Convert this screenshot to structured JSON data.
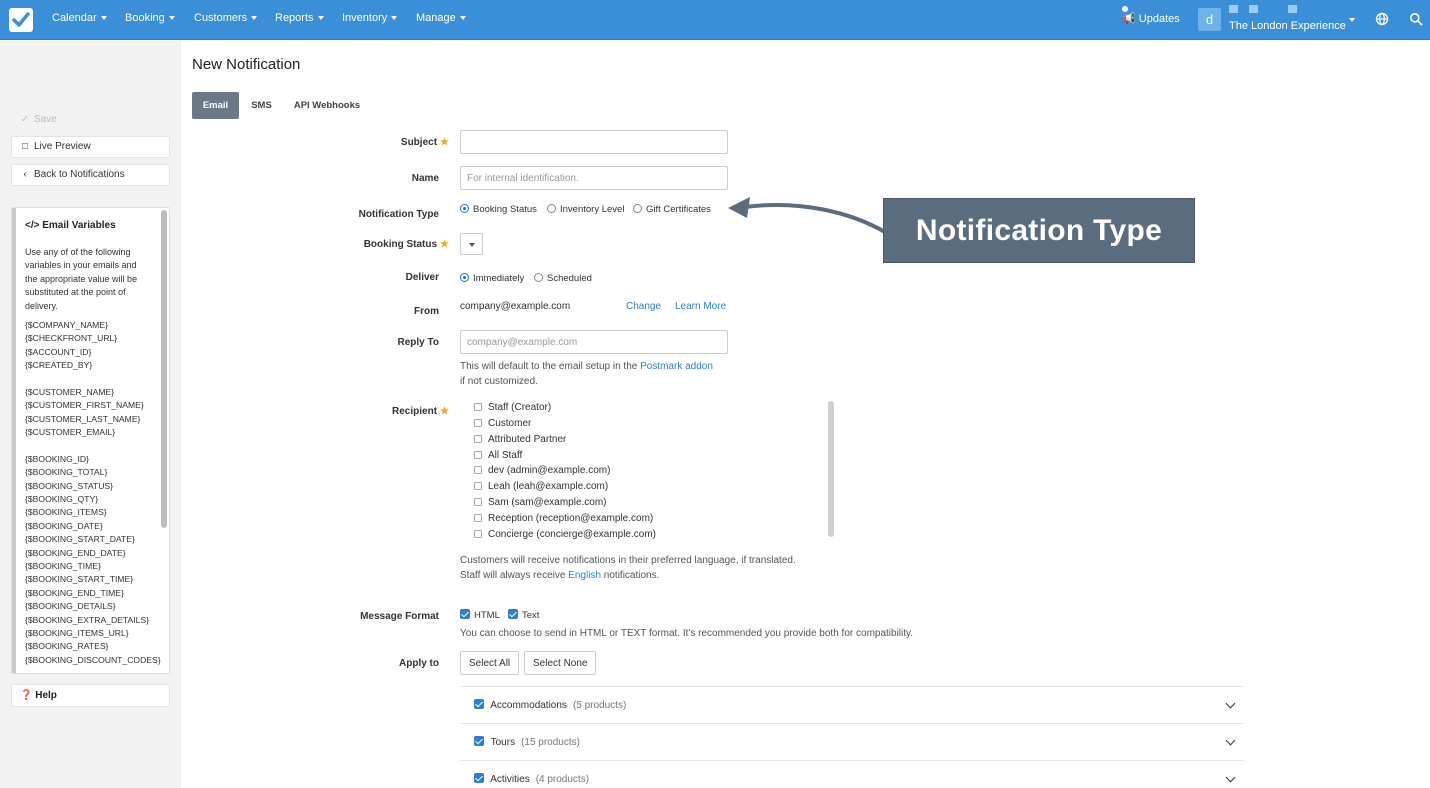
{
  "navbar": {
    "menus": [
      "Calendar",
      "Booking",
      "Customers",
      "Reports",
      "Inventory",
      "Manage"
    ],
    "updates_label": "Updates",
    "avatar_letter": "d",
    "account_name": "The London Experience"
  },
  "sidebar": {
    "save_label": "Save",
    "live_preview_label": "Live Preview",
    "back_label": "Back to Notifications",
    "variables_title": "Email Variables",
    "variables_description": "Use any of of the following variables in your emails and the appropriate value will be substituted at the point of delivery.",
    "variables": [
      "{$COMPANY_NAME}",
      "{$CHECKFRONT_URL}",
      "{$ACCOUNT_ID}",
      "{$CREATED_BY}",
      "",
      "{$CUSTOMER_NAME}",
      "{$CUSTOMER_FIRST_NAME}",
      "{$CUSTOMER_LAST_NAME}",
      "{$CUSTOMER_EMAIL}",
      "",
      "{$BOOKING_ID}",
      "{$BOOKING_TOTAL}",
      "{$BOOKING_STATUS}",
      "{$BOOKING_QTY}",
      "{$BOOKING_ITEMS}",
      "{$BOOKING_DATE}",
      "{$BOOKING_START_DATE}",
      "{$BOOKING_END_DATE}",
      "{$BOOKING_TIME}",
      "{$BOOKING_START_TIME}",
      "{$BOOKING_END_TIME}",
      "{$BOOKING_DETAILS}",
      "{$BOOKING_EXTRA_DETAILS}",
      "{$BOOKING_ITEMS_URL}",
      "{$BOOKING_RATES}",
      "{$BOOKING_DISCOUNT_CODES}"
    ],
    "help_label": "Help"
  },
  "page": {
    "title": "New Notification",
    "tabs": [
      "Email",
      "SMS",
      "API Webhooks"
    ]
  },
  "form": {
    "subject_label": "Subject",
    "name_label": "Name",
    "name_placeholder": "For internal identification.",
    "notification_type_label": "Notification Type",
    "notification_types": [
      "Booking Status",
      "Inventory Level",
      "Gift Certificates"
    ],
    "booking_status_label": "Booking Status",
    "deliver_label": "Deliver",
    "deliver_options": [
      "Immediately",
      "Scheduled"
    ],
    "from_label": "From",
    "from_value": "company@example.com",
    "change_link": "Change",
    "learn_more_link": "Learn More",
    "reply_to_label": "Reply To",
    "reply_to_placeholder": "company@example.com",
    "reply_help_1": "This will default to the email setup in the ",
    "reply_help_link": "Postmark addon",
    "reply_help_2": "if not customized.",
    "recipient_label": "Recipient",
    "recipients": [
      "Staff (Creator)",
      "Customer",
      "Attributed Partner",
      "All Staff",
      "dev (admin@example.com)",
      "Leah (leah@example.com)",
      "Sam (sam@example.com)",
      "Reception (reception@example.com)",
      "Concierge (concierge@example.com)"
    ],
    "language_help_1": "Customers will receive notifications in their preferred language, if translated.",
    "language_help_2a": "Staff will always receive ",
    "language_help_link": "English",
    "language_help_2b": " notifications.",
    "message_format_label": "Message Format",
    "formats": [
      "HTML",
      "Text"
    ],
    "format_help": "You can choose to send in HTML or TEXT format. It's recommended you provide both for compatibility.",
    "apply_to_label": "Apply to",
    "select_all_label": "Select All",
    "select_none_label": "Select None",
    "categories": [
      {
        "name": "Accommodations",
        "count": "(5 products)"
      },
      {
        "name": "Tours",
        "count": "(15 products)"
      },
      {
        "name": "Activities",
        "count": "(4 products)"
      }
    ]
  },
  "callout": {
    "text": "Notification Type",
    "color": "#5c6c7f"
  },
  "colors": {
    "navbar": "#3a8fd8",
    "accent": "#2a7fd4",
    "required": "#f0a81a"
  }
}
